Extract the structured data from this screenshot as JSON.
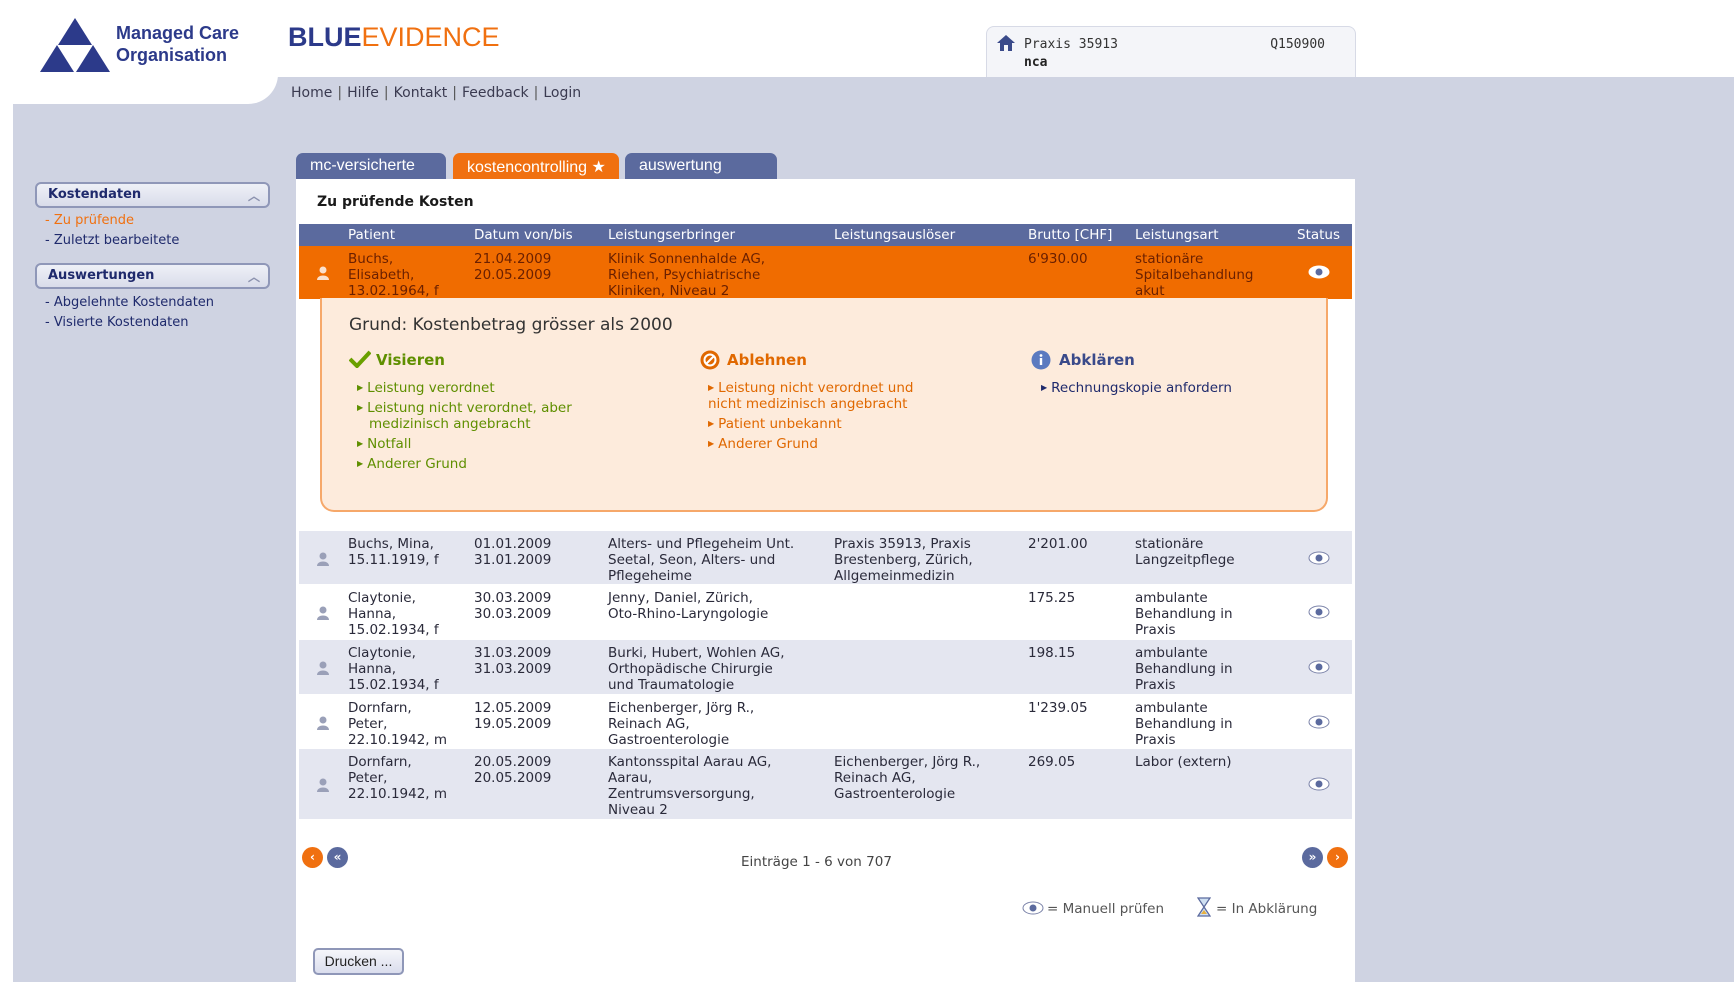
{
  "logo": {
    "line1": "Managed Care",
    "line2": "Organisation"
  },
  "brand": {
    "part1": "BLUE",
    "part2": "EVIDENCE"
  },
  "topnav": [
    "Home",
    "Hilfe",
    "Kontakt",
    "Feedback",
    "Login"
  ],
  "practice": {
    "name": "Praxis 35913",
    "user": "nca",
    "id": "Q150900"
  },
  "sidebar": {
    "groups": [
      {
        "title": "Kostendaten",
        "items": [
          "Zu prüfende",
          "Zuletzt bearbeitete"
        ]
      },
      {
        "title": "Auswertungen",
        "items": [
          "Abgelehnte Kostendaten",
          "Visierte Kostendaten"
        ]
      }
    ]
  },
  "tabs": [
    "mc-versicherte",
    "kostencontrolling ★",
    "auswertung"
  ],
  "section_title": "Zu prüfende Kosten",
  "table": {
    "headers": [
      "Patient",
      "Datum von/bis",
      "Leistungserbringer",
      "Leistungsauslöser",
      "Brutto [CHF]",
      "Leistungsart",
      "Status"
    ],
    "rows": [
      {
        "patient": "Buchs,\nElisabeth,\n13.02.1964, f",
        "dates": "21.04.2009\n20.05.2009",
        "provider": "Klinik Sonnenhalde AG,\nRiehen, Psychiatrische\nKliniken, Niveau 2",
        "trigger": "",
        "amount": "6'930.00",
        "type": "stationäre\nSpitalbehandlung\nakut"
      },
      {
        "patient": "Buchs, Mina,\n15.11.1919, f",
        "dates": "01.01.2009\n31.01.2009",
        "provider": "Alters- und Pflegeheim Unt.\nSeetal, Seon, Alters- und\nPflegeheime",
        "trigger": "Praxis 35913, Praxis\nBrestenberg, Zürich,\nAllgemeinmedizin",
        "amount": "2'201.00",
        "type": "stationäre\nLangzeitpflege"
      },
      {
        "patient": "Claytonie,\nHanna,\n15.02.1934, f",
        "dates": "30.03.2009\n30.03.2009",
        "provider": "Jenny, Daniel, Zürich,\nOto-Rhino-Laryngologie",
        "trigger": "",
        "amount": "175.25",
        "type": "ambulante\nBehandlung in\nPraxis"
      },
      {
        "patient": "Claytonie,\nHanna,\n15.02.1934, f",
        "dates": "31.03.2009\n31.03.2009",
        "provider": "Burki, Hubert, Wohlen AG,\nOrthopädische Chirurgie\nund Traumatologie",
        "trigger": "",
        "amount": "198.15",
        "type": "ambulante\nBehandlung in\nPraxis"
      },
      {
        "patient": "Dornfarn,\nPeter,\n22.10.1942, m",
        "dates": "12.05.2009\n19.05.2009",
        "provider": "Eichenberger, Jörg R.,\nReinach AG,\nGastroenterologie",
        "trigger": "",
        "amount": "1'239.05",
        "type": "ambulante\nBehandlung in\nPraxis"
      },
      {
        "patient": "Dornfarn,\nPeter,\n22.10.1942, m",
        "dates": "20.05.2009\n20.05.2009",
        "provider": "Kantonsspital Aarau AG,\nAarau,\nZentrumsversorgung,\nNiveau 2",
        "trigger": "Eichenberger, Jörg R.,\nReinach AG,\nGastroenterologie",
        "amount": "269.05",
        "type": "Labor (extern)"
      }
    ]
  },
  "detail": {
    "reason": "Grund: Kostenbetrag grösser als 2000",
    "visieren": {
      "title": "Visieren",
      "options": [
        "Leistung verordnet",
        "Leistung nicht verordnet, aber\nmedizinisch angebracht",
        "Notfall",
        "Anderer Grund"
      ]
    },
    "ablehnen": {
      "title": "Ablehnen",
      "options": [
        "Leistung nicht verordnet und\nnicht medizinisch angebracht",
        "Patient unbekannt",
        "Anderer Grund"
      ]
    },
    "abklaeren": {
      "title": "Abklären",
      "options": [
        "Rechnungskopie anfordern"
      ]
    }
  },
  "pager": {
    "text": "Einträge 1 - 6 von 707"
  },
  "legend": {
    "eye": "= Manuell prüfen",
    "hourglass": "= In Abklärung"
  },
  "print_button": "Drucken ...",
  "colors": {
    "accent": "#f07010",
    "navy": "#5b6a9e",
    "panel": "#cfd3e2"
  }
}
